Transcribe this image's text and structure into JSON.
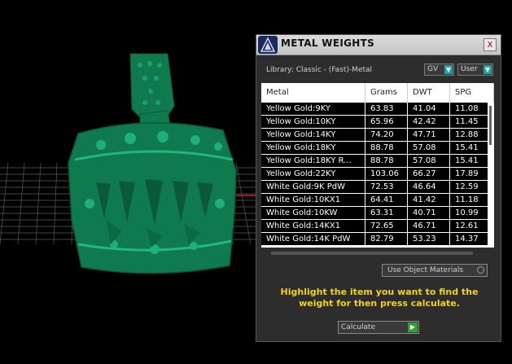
{
  "panel": {
    "title": "METAL WEIGHTS",
    "close_label": "x",
    "library": "Library: Classic - (Fast)-Metal",
    "unit_select": "GV",
    "user_select": "User"
  },
  "table": {
    "headers": [
      "Metal",
      "Grams",
      "DWT",
      "SPG"
    ],
    "rows": [
      [
        "Yellow Gold:9KY",
        "63.83",
        "41.04",
        "11.08"
      ],
      [
        "Yellow Gold:10KY",
        "65.96",
        "42.42",
        "11.45"
      ],
      [
        "Yellow Gold:14KY",
        "74.20",
        "47.71",
        "12.88"
      ],
      [
        "Yellow Gold:18KY",
        "88.78",
        "57.08",
        "15.41"
      ],
      [
        "Yellow Gold:18KY R...",
        "88.78",
        "57.08",
        "15.41"
      ],
      [
        "Yellow Gold:22KY",
        "103.06",
        "66.27",
        "17.89"
      ],
      [
        "White Gold:9K PdW",
        "72.53",
        "46.64",
        "12.59"
      ],
      [
        "White Gold:10KX1",
        "64.41",
        "41.42",
        "11.18"
      ],
      [
        "White Gold:10KW",
        "63.31",
        "40.71",
        "10.99"
      ],
      [
        "White Gold:14KX1",
        "72.65",
        "46.71",
        "12.61"
      ],
      [
        "White Gold:14K PdW",
        "82.79",
        "53.23",
        "14.37"
      ]
    ]
  },
  "material_option": "Use Object Materials",
  "hint": "Highlight the item you want to find the weight for then press calculate.",
  "calculate_label": "Calculate",
  "colors": {
    "model": "#0f7a4e",
    "hint": "#f2d21a",
    "accent": "#19a5a5"
  },
  "icons": [
    "app-logo-icon",
    "close-icon",
    "dropdown-arrow-icon",
    "radio-icon",
    "play-icon"
  ]
}
